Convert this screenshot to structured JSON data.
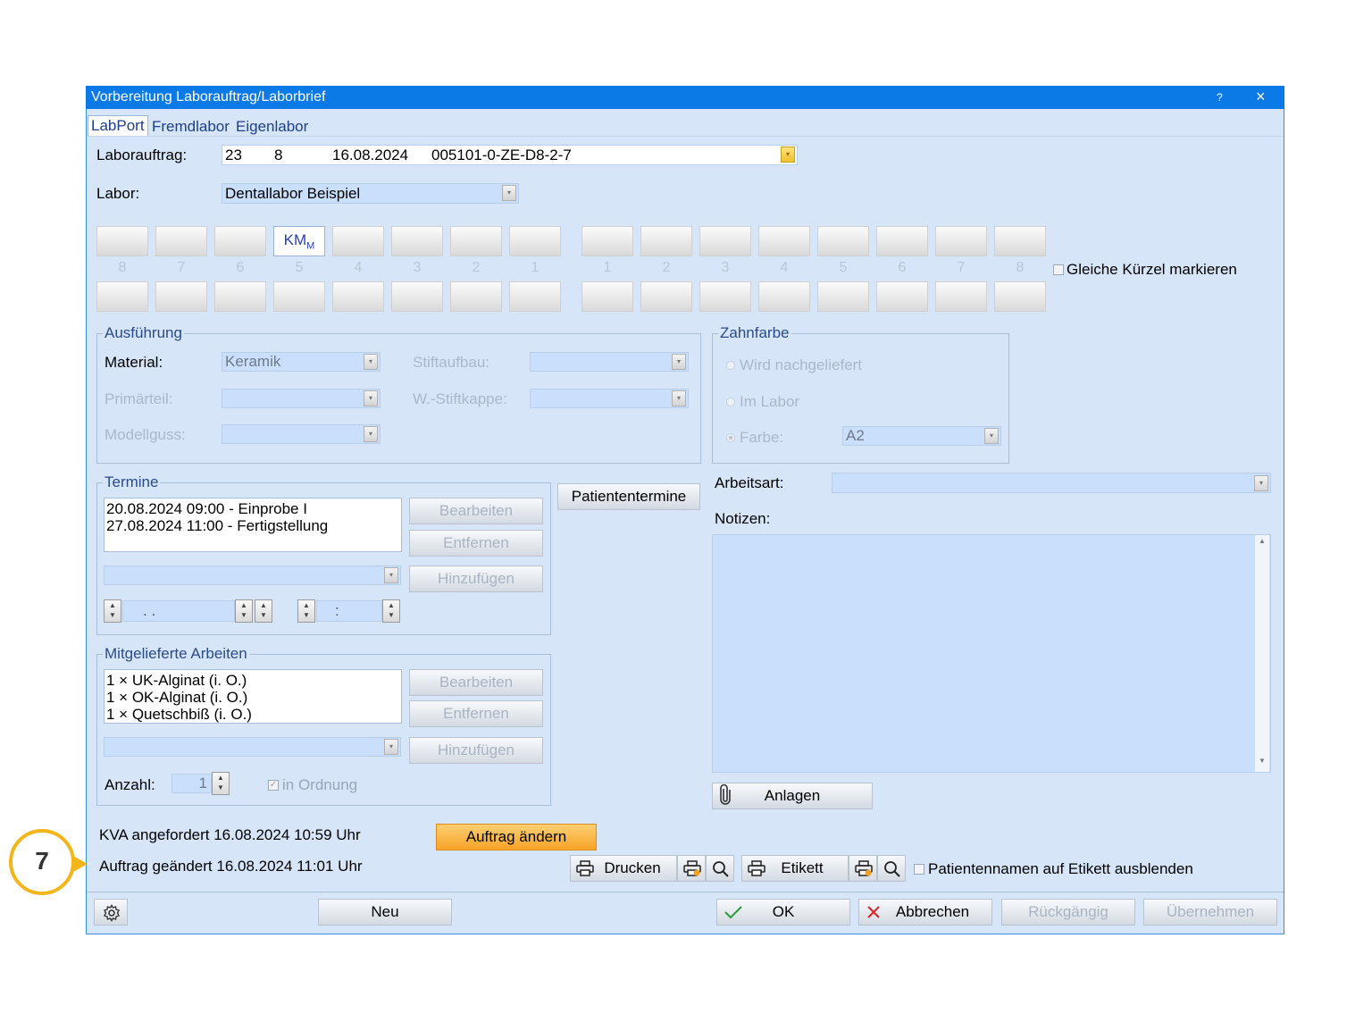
{
  "window": {
    "title": "Vorbereitung Laborauftrag/Laborbrief",
    "help": "?",
    "close": "×"
  },
  "tabs": [
    "LabPort",
    "Fremdlabor",
    "Eigenlabor"
  ],
  "laborauftrag": {
    "label": "Laborauftrag:",
    "c1": "23",
    "c2": "8",
    "c3": "16.08.2024",
    "c4": "005101-0-ZE-D8-2-7"
  },
  "labor": {
    "label": "Labor:",
    "value": "Dentallabor Beispiel"
  },
  "teeth": {
    "upper_left": [
      "",
      "",
      "",
      "KM",
      "",
      "",
      "",
      ""
    ],
    "km_sub": "M",
    "numbers_left": [
      "8",
      "7",
      "6",
      "5",
      "4",
      "3",
      "2",
      "1"
    ],
    "numbers_right": [
      "1",
      "2",
      "3",
      "4",
      "5",
      "6",
      "7",
      "8"
    ],
    "same_marker_label": "Gleiche Kürzel markieren"
  },
  "ausfuehrung": {
    "title": "Ausführung",
    "material_label": "Material:",
    "material_value": "Keramik",
    "stiftaufbau_label": "Stiftaufbau:",
    "primaerteil_label": "Primärteil:",
    "wstiftkappe_label": "W.-Stiftkappe:",
    "modellguss_label": "Modellguss:"
  },
  "zahnfarbe": {
    "title": "Zahnfarbe",
    "opt1": "Wird nachgeliefert",
    "opt2": "Im Labor",
    "opt3": "Farbe:",
    "farbe_value": "A2"
  },
  "termine": {
    "title": "Termine",
    "items": [
      "20.08.2024 09:00 - Einprobe I",
      "27.08.2024 11:00 - Fertigstellung"
    ],
    "edit": "Bearbeiten",
    "remove": "Entfernen",
    "add": "Hinzufügen",
    "date_placeholder": ". .",
    "time_placeholder": ":",
    "patient_btn": "Patiententermine"
  },
  "arbeitsart": {
    "label": "Arbeitsart:"
  },
  "notizen": {
    "label": "Notizen:"
  },
  "mitgeliefert": {
    "title": "Mitgelieferte Arbeiten",
    "items": [
      "1 × UK-Alginat  (i. O.)",
      "1 × OK-Alginat  (i. O.)",
      "1 × Quetschbiß  (i. O.)"
    ],
    "edit": "Bearbeiten",
    "remove": "Entfernen",
    "add": "Hinzufügen",
    "anzahl_label": "Anzahl:",
    "anzahl_value": "1",
    "in_ordnung": "in Ordnung"
  },
  "anlagen": "Anlagen",
  "status": {
    "kva": "KVA angefordert 16.08.2024 10:59 Uhr",
    "geaendert": "Auftrag geändert 16.08.2024 11:01 Uhr",
    "auftrag_aendern": "Auftrag ändern"
  },
  "print": {
    "drucken": "Drucken",
    "etikett": "Etikett",
    "hide_names": "Patientennamen auf Etikett ausblenden"
  },
  "footer": {
    "neu": "Neu",
    "ok": "OK",
    "abbrechen": "Abbrechen",
    "rueckgaengig": "Rückgängig",
    "uebernehmen": "Übernehmen"
  },
  "marker": "7",
  "colors": {
    "titlebar": "#0c7ae6",
    "dialog_bg": "#d6e6f8",
    "accent_orange": "#f7a326",
    "marker": "#f4b51b"
  }
}
